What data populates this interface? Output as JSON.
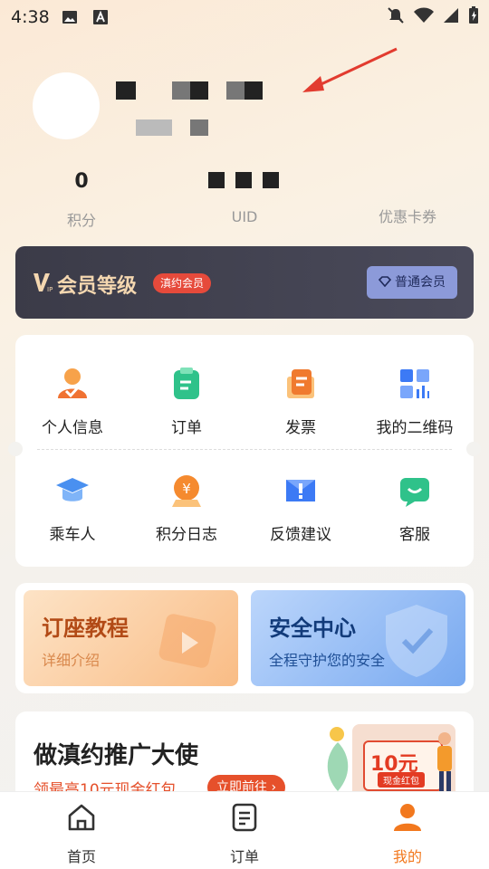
{
  "status_bar": {
    "time": "4:38"
  },
  "profile": {},
  "stats": [
    {
      "value": "0",
      "label": "积分"
    },
    {
      "value": "",
      "label": "UID"
    },
    {
      "value": "",
      "label": "优惠卡券"
    }
  ],
  "vip": {
    "title": "会员等级",
    "badge": "滇约会员",
    "level_button": "普通会员",
    "colors": {
      "bg": "#3b3b48",
      "title": "#f4d7b0",
      "badge": "#e64a3b",
      "button": "#8c9ad9"
    }
  },
  "grid": {
    "row1": [
      {
        "label": "个人信息",
        "icon": "user-info-icon"
      },
      {
        "label": "订单",
        "icon": "order-icon"
      },
      {
        "label": "发票",
        "icon": "invoice-icon"
      },
      {
        "label": "我的二维码",
        "icon": "qrcode-icon"
      }
    ],
    "row2": [
      {
        "label": "乘车人",
        "icon": "passenger-icon"
      },
      {
        "label": "积分日志",
        "icon": "points-log-icon"
      },
      {
        "label": "反馈建议",
        "icon": "feedback-icon"
      },
      {
        "label": "客服",
        "icon": "customer-service-icon"
      }
    ]
  },
  "promos": {
    "booking": {
      "title": "订座教程",
      "subtitle": "详细介绍"
    },
    "security": {
      "title": "安全中心",
      "subtitle": "全程守护您的安全"
    }
  },
  "invite": {
    "title": "做滇约推广大使",
    "subtitle": "领最高10元现金红包",
    "button": "立即前往 ›",
    "amount": "10元",
    "tag": "现金红包"
  },
  "tabbar": [
    {
      "label": "首页",
      "icon": "home-icon"
    },
    {
      "label": "订单",
      "icon": "order-list-icon"
    },
    {
      "label": "我的",
      "icon": "profile-icon",
      "active": true
    }
  ],
  "accent": "#f2781e"
}
